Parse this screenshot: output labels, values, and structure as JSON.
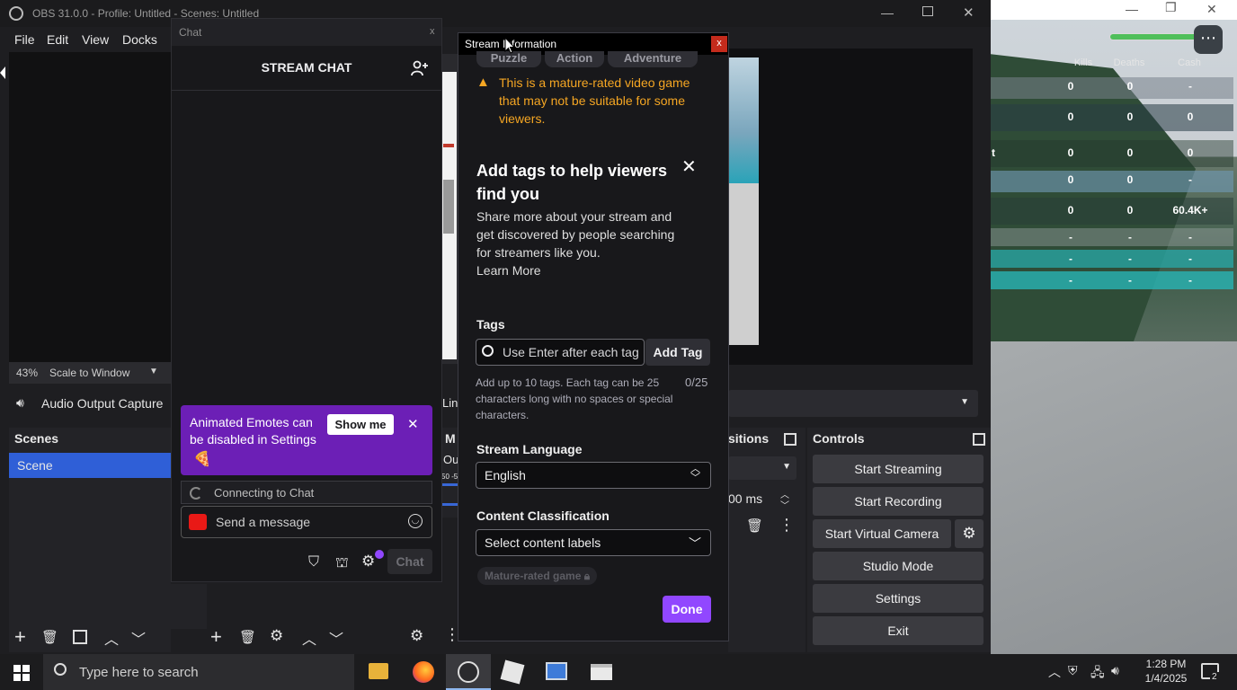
{
  "obs": {
    "title": "OBS 31.0.0 - Profile: Untitled - Scenes: Untitled",
    "menu": [
      "File",
      "Edit",
      "View",
      "Docks"
    ],
    "scale_percent": "43%",
    "scale_mode": "Scale to Window",
    "audio_source": "Audio Output Capture",
    "scenes_title": "Scenes",
    "scene_item": "Scene",
    "transitions_title": "sitions",
    "transition_ms": "00 ms",
    "controls_title": "Controls",
    "controls": [
      "Start Streaming",
      "Start Recording",
      "Start Virtual Camera",
      "Studio Mode",
      "Settings",
      "Exit"
    ],
    "partial_labels": {
      "lin": "Lin",
      "m": "M",
      "ou": "Ou",
      "scale": "50 -5"
    }
  },
  "chat": {
    "window_title": "Chat",
    "close": "x",
    "header": "STREAM CHAT",
    "banner_text": "Animated Emotes can be disabled in Settings",
    "banner_button": "Show me",
    "banner_close": "✕",
    "connecting": "Connecting to Chat",
    "send_placeholder": "Send a message",
    "chat_button": "Chat"
  },
  "stream_info": {
    "title": "Stream Information",
    "close": "x",
    "category_tags": [
      "Puzzle",
      "Action",
      "Adventure"
    ],
    "warning": "This is a mature-rated video game that may not be suitable for some viewers.",
    "promo_title": "Add tags to help viewers find you",
    "promo_body": "Share more about your stream and get discovered by people searching for streamers like you.",
    "learn_more": "Learn More",
    "tags_label": "Tags",
    "tags_placeholder": "Use Enter after each tag",
    "add_tag": "Add Tag",
    "tags_help": "Add up to 10 tags. Each tag can be 25 characters long with no spaces or special characters.",
    "tags_count": "0/25",
    "language_label": "Stream Language",
    "language_value": "English",
    "classification_label": "Content Classification",
    "classification_placeholder": "Select content labels",
    "mature_chip": "Mature-rated game",
    "done": "Done"
  },
  "game": {
    "headers": [
      "Kills",
      "Deaths",
      "Cash"
    ],
    "rows": [
      {
        "prefix": "",
        "kills": "0",
        "deaths": "0",
        "cash": "-"
      },
      {
        "prefix": "",
        "kills": "0",
        "deaths": "0",
        "cash": "0"
      },
      {
        "prefix": "t",
        "kills": "0",
        "deaths": "0",
        "cash": "0"
      },
      {
        "prefix": "",
        "kills": "0",
        "deaths": "0",
        "cash": "-"
      },
      {
        "prefix": "",
        "kills": "0",
        "deaths": "0",
        "cash": "60.4K+"
      },
      {
        "prefix": "",
        "kills": "-",
        "deaths": "-",
        "cash": "-"
      },
      {
        "prefix": "",
        "kills": "-",
        "deaths": "-",
        "cash": "-"
      },
      {
        "prefix": "",
        "kills": "-",
        "deaths": "-",
        "cash": "-"
      }
    ],
    "health_fraction": 1.0
  },
  "taskbar": {
    "search_placeholder": "Type here to search",
    "time": "1:28 PM",
    "date": "1/4/2025",
    "notification_count": "2"
  },
  "colors": {
    "twitch_purple": "#9147ff",
    "warning_orange": "#f5a623",
    "scene_selected": "#2f5fd7",
    "banner_purple": "#6c1fb6"
  }
}
